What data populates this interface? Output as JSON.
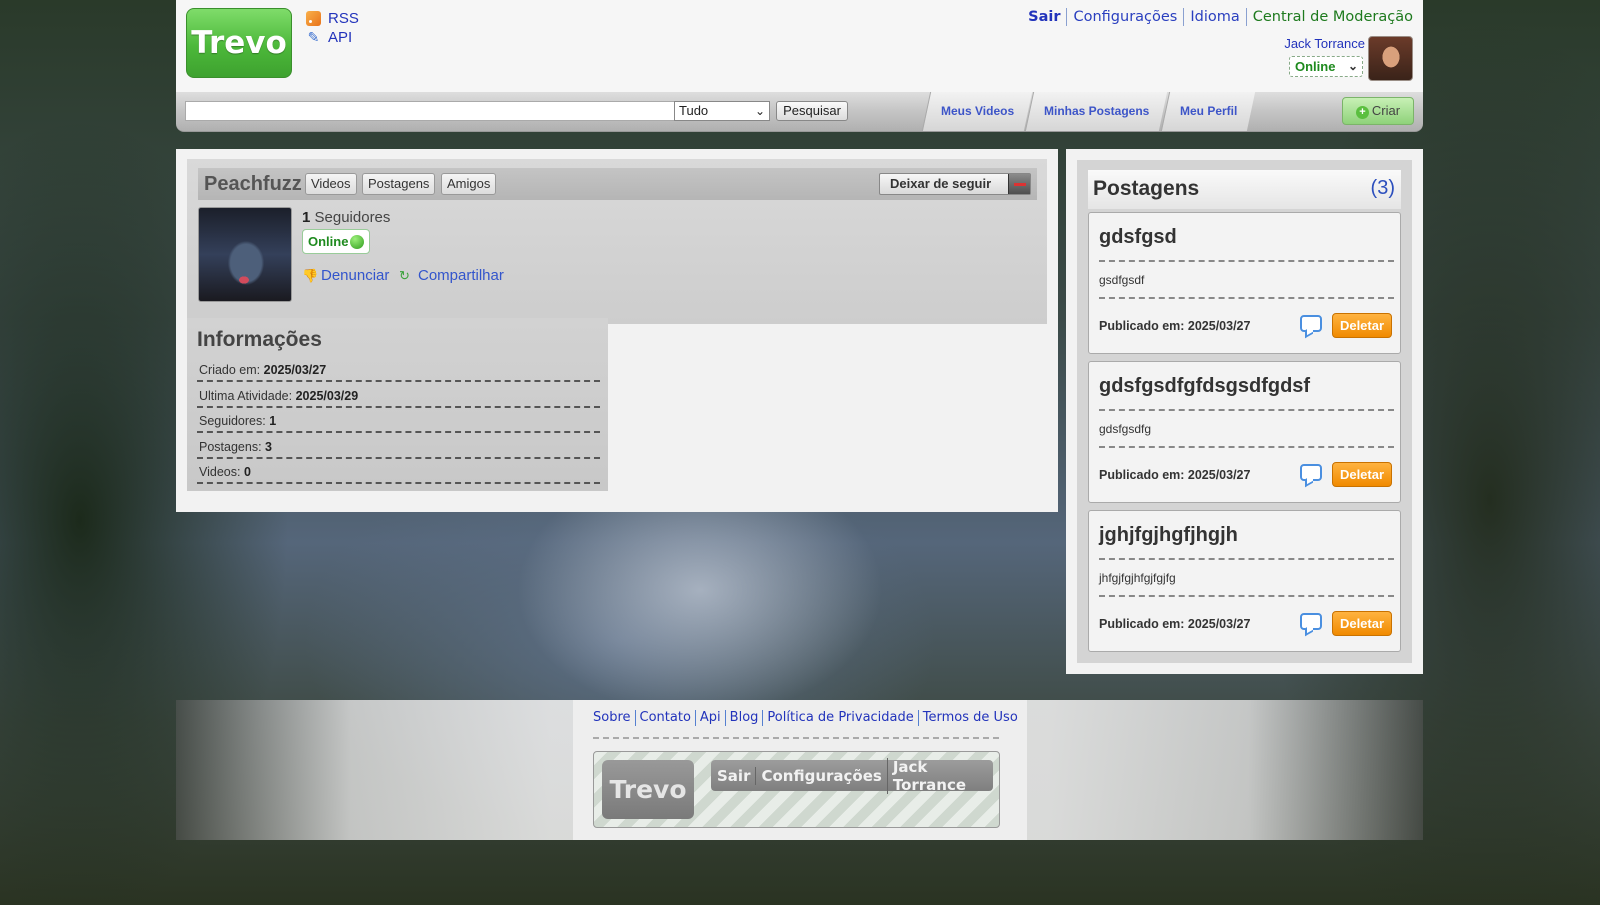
{
  "header": {
    "logo_text": "Trevo",
    "feed_links": [
      {
        "label": "RSS",
        "icon": "rss-icon"
      },
      {
        "label": "API",
        "icon": "feather-icon"
      }
    ],
    "nav": {
      "logout": "Sair",
      "settings": "Configurações",
      "language": "Idioma",
      "moderation": "Central de Moderação"
    },
    "user": {
      "name": "Jack Torrance",
      "status": "Online"
    }
  },
  "search": {
    "placeholder": "",
    "scope_selected": "Tudo",
    "button_label": "Pesquisar",
    "tabs": [
      "Meus Videos",
      "Minhas Postagens",
      "Meu Perfil"
    ],
    "create_label": "Criar"
  },
  "profile": {
    "name": "Peachfuzz",
    "tabs": [
      "Videos",
      "Postagens",
      "Amigos"
    ],
    "unfollow_label": "Deixar de seguir",
    "followers_count": "1",
    "followers_label": "Seguidores",
    "status": "Online",
    "report_label": "Denunciar",
    "share_label": "Compartilhar"
  },
  "info": {
    "title": "Informações",
    "rows": [
      {
        "label": "Criado em:",
        "value": "2025/03/27"
      },
      {
        "label": "Ultima Atividade:",
        "value": "2025/03/29"
      },
      {
        "label": "Seguidores:",
        "value": "1"
      },
      {
        "label": "Postagens:",
        "value": "3"
      },
      {
        "label": "Videos:",
        "value": "0"
      }
    ]
  },
  "posts": {
    "title": "Postagens",
    "count": "(3)",
    "items": [
      {
        "title": "gdsfgsd",
        "body": "gsdfgsdf",
        "date": "Publicado em: 2025/03/27",
        "delete_label": "Deletar"
      },
      {
        "title": "gdsfgsdfgfdsgsdfgdsf",
        "body": "gdsfgsdfg",
        "date": "Publicado em: 2025/03/27",
        "delete_label": "Deletar"
      },
      {
        "title": "jghjfgjhgfjhgjh",
        "body": "jhfgjfgjhfgjfgjfg",
        "date": "Publicado em: 2025/03/27",
        "delete_label": "Deletar"
      }
    ]
  },
  "footer": {
    "links": [
      "Sobre",
      "Contato",
      "Api",
      "Blog",
      "Política de Privacidade",
      "Termos de Uso"
    ],
    "logo_text": "Trevo",
    "nav": [
      "Sair",
      "Configurações",
      "Jack Torrance"
    ]
  },
  "colors": {
    "logo_green": "#4cb83a",
    "link_blue": "#2233bb",
    "delete_orange": "#f08a00",
    "online_green": "#1e8a1e"
  }
}
